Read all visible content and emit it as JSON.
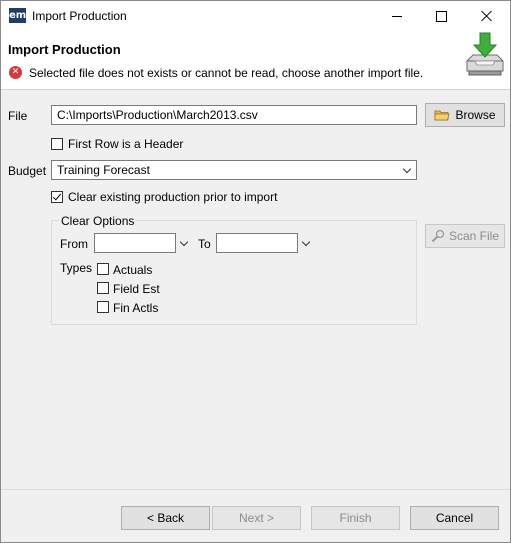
{
  "window": {
    "app_icon": "em",
    "title": "Import Production"
  },
  "banner": {
    "title": "Import Production",
    "error_message": "Selected file does not exists or cannot be read, choose another import file."
  },
  "form": {
    "file_label": "File",
    "file_value": "C:\\Imports\\Production\\March2013.csv",
    "browse_label": "Browse",
    "first_row_header_label": "First Row is a Header",
    "first_row_header_checked": false,
    "budget_label": "Budget",
    "budget_value": "Training Forecast",
    "clear_existing_label": "Clear existing production prior to import",
    "clear_existing_checked": true,
    "scan_file_label": "Scan File"
  },
  "clear_options": {
    "title": "Clear Options",
    "from_label": "From",
    "from_value": "",
    "to_label": "To",
    "to_value": "",
    "types_label": "Types",
    "types": [
      {
        "label": "Actuals",
        "checked": false
      },
      {
        "label": "Field Est",
        "checked": false
      },
      {
        "label": "Fin Actls",
        "checked": false
      }
    ]
  },
  "footer": {
    "back_label": "< Back",
    "next_label": "Next >",
    "finish_label": "Finish",
    "cancel_label": "Cancel"
  },
  "icons": {
    "app": "em-logo-icon",
    "error": "error-icon",
    "banner": "import-tray-icon",
    "browse": "folder-icon",
    "scan": "magnifier-icon"
  },
  "colors": {
    "error_red": "#d43a3a",
    "arrow_green": "#3fae3a",
    "app_icon_blue": "#1f3e66"
  }
}
